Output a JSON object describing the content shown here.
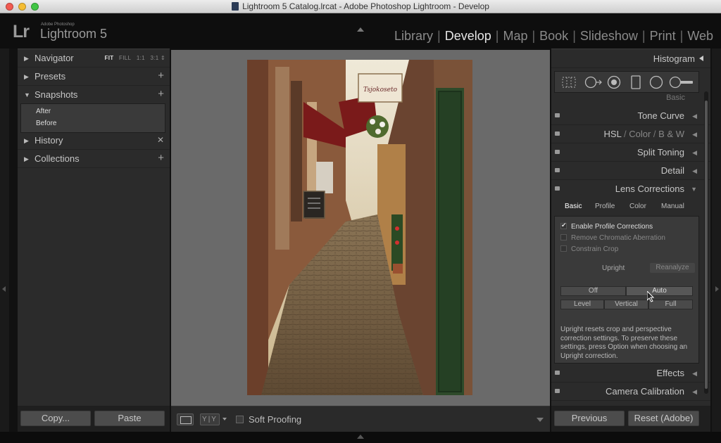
{
  "window": {
    "title": "Lightroom 5 Catalog.lrcat - Adobe Photoshop Lightroom - Develop"
  },
  "header": {
    "logo": "Lr",
    "brand_small": "Adobe Photoshop",
    "brand_name": "Lightroom 5",
    "modules": [
      "Library",
      "Develop",
      "Map",
      "Book",
      "Slideshow",
      "Print",
      "Web"
    ],
    "active_module": "Develop"
  },
  "left_panel": {
    "navigator": {
      "label": "Navigator",
      "options": [
        "FIT",
        "FILL",
        "1:1",
        "3:1"
      ],
      "selected_option": "FIT"
    },
    "presets": {
      "label": "Presets"
    },
    "snapshots": {
      "label": "Snapshots",
      "items": [
        "After",
        "Before"
      ]
    },
    "history": {
      "label": "History"
    },
    "collections": {
      "label": "Collections"
    },
    "copy_label": "Copy...",
    "paste_label": "Paste"
  },
  "toolbar": {
    "yy_label": "Y|Y",
    "soft_proofing_label": "Soft Proofing"
  },
  "right_panel": {
    "histogram_label": "Histogram",
    "basic_peek": "Basic",
    "sections": {
      "tone_curve": "Tone Curve",
      "hsl": "HSL",
      "color": "Color",
      "bw": "B & W",
      "split_toning": "Split Toning",
      "detail": "Detail",
      "lens_corrections": "Lens Corrections",
      "effects": "Effects",
      "camera_calibration": "Camera Calibration"
    },
    "lens": {
      "tabs": [
        "Basic",
        "Profile",
        "Color",
        "Manual"
      ],
      "active_tab": "Basic",
      "enable_profile": "Enable Profile Corrections",
      "remove_ca": "Remove Chromatic Aberration",
      "constrain_crop": "Constrain Crop",
      "enable_profile_checked": true,
      "remove_ca_checked": false,
      "constrain_crop_checked": false,
      "upright_label": "Upright",
      "reanalyze_label": "Reanalyze",
      "upright_modes_row1": [
        "Off",
        "Auto"
      ],
      "upright_modes_row2": [
        "Level",
        "Vertical",
        "Full"
      ],
      "upright_description": "Upright resets crop and perspective correction settings. To preserve these settings, press Option when choosing an Upright correction."
    },
    "previous_label": "Previous",
    "reset_label": "Reset (Adobe)"
  },
  "photo": {
    "shop_sign": "Tsjokoseto"
  }
}
